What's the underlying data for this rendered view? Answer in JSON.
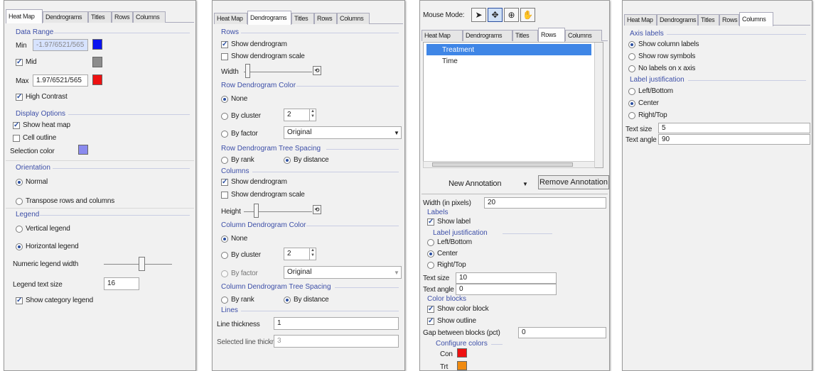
{
  "tabs": [
    "Heat Map",
    "Dendrograms",
    "Titles",
    "Rows",
    "Columns"
  ],
  "panel1": {
    "data_range": "Data Range",
    "min_label": "Min",
    "min_value": "-1.97/6521/565",
    "min_color": "#0a14f0",
    "mid_label": "Mid",
    "mid_color": "#8c8c8c",
    "max_label": "Max",
    "max_value": "1.97/6521/565",
    "max_color": "#ee1111",
    "high_contrast": "High Contrast",
    "display_options": "Display Options",
    "show_heat_map": "Show heat map",
    "cell_outline": "Cell outline",
    "selection_color_label": "Selection color",
    "selection_color": "#8a8aee",
    "orientation": "Orientation",
    "normal": "Normal",
    "transpose": "Transpose rows and columns",
    "legend": "Legend",
    "vertical_legend": "Vertical legend",
    "horizontal_legend": "Horizontal legend",
    "numeric_legend_width": "Numeric legend width",
    "numeric_legend_level": 0.55,
    "legend_text_size_label": "Legend text size",
    "legend_text_size": "16",
    "show_category_legend": "Show category legend"
  },
  "panel2": {
    "rows": "Rows",
    "show_dendrogram": "Show dendrogram",
    "show_dendrogram_scale": "Show dendrogram scale",
    "width": "Width",
    "row_dendrogram_color": "Row Dendrogram Color",
    "none": "None",
    "by_cluster": "By cluster",
    "cluster_value": "2",
    "by_factor": "By factor",
    "factor_value": "Original",
    "row_tree_spacing": "Row Dendrogram Tree Spacing",
    "by_rank": "By rank",
    "by_distance": "By distance",
    "columns": "Columns",
    "col_show_dendrogram": "Show dendrogram",
    "col_show_dendrogram_scale": "Show dendrogram scale",
    "height": "Height",
    "column_dendrogram_color": "Column Dendrogram Color",
    "col_none": "None",
    "col_by_cluster": "By cluster",
    "col_cluster_value": "2",
    "col_by_factor": "By factor",
    "col_factor_value": "Original",
    "column_tree_spacing": "Column Dendrogram Tree Spacing",
    "col_by_rank": "By rank",
    "col_by_distance": "By distance",
    "lines": "Lines",
    "line_thickness": "Line thickness",
    "line_thickness_value": "1",
    "selected_line_thickness": "Selected line thickness",
    "selected_line_thickness_value": "3"
  },
  "panel3": {
    "mouse_mode": "Mouse Mode:",
    "list_items": [
      "Treatment",
      "Time"
    ],
    "new_annotation": "New Annotation",
    "remove_annotation": "Remove Annotation",
    "width_label": "Width (in pixels)",
    "width_value": "20",
    "labels": "Labels",
    "show_label": "Show label",
    "label_justification": "Label justification",
    "left_bottom": "Left/Bottom",
    "center": "Center",
    "right_top": "Right/Top",
    "text_size_label": "Text size",
    "text_size_value": "10",
    "text_angle_label": "Text angle",
    "text_angle_value": "0",
    "color_blocks": "Color blocks",
    "show_color_block": "Show color block",
    "show_outline": "Show outline",
    "gap_label": "Gap between blocks (pct)",
    "gap_value": "0",
    "configure_colors": "Configure colors",
    "colors": [
      {
        "name": "Con",
        "color": "#ee1111"
      },
      {
        "name": "Trt",
        "color": "#f08a10"
      }
    ]
  },
  "panel4": {
    "axis_labels": "Axis labels",
    "show_column_labels": "Show column labels",
    "show_row_symbols": "Show row symbols",
    "no_labels": "No labels on x axis",
    "label_justification": "Label justification",
    "left_bottom": "Left/Bottom",
    "center": "Center",
    "right_top": "Right/Top",
    "text_size_label": "Text size",
    "text_size_value": "5",
    "text_angle_label": "Text angle",
    "text_angle_value": "90"
  }
}
